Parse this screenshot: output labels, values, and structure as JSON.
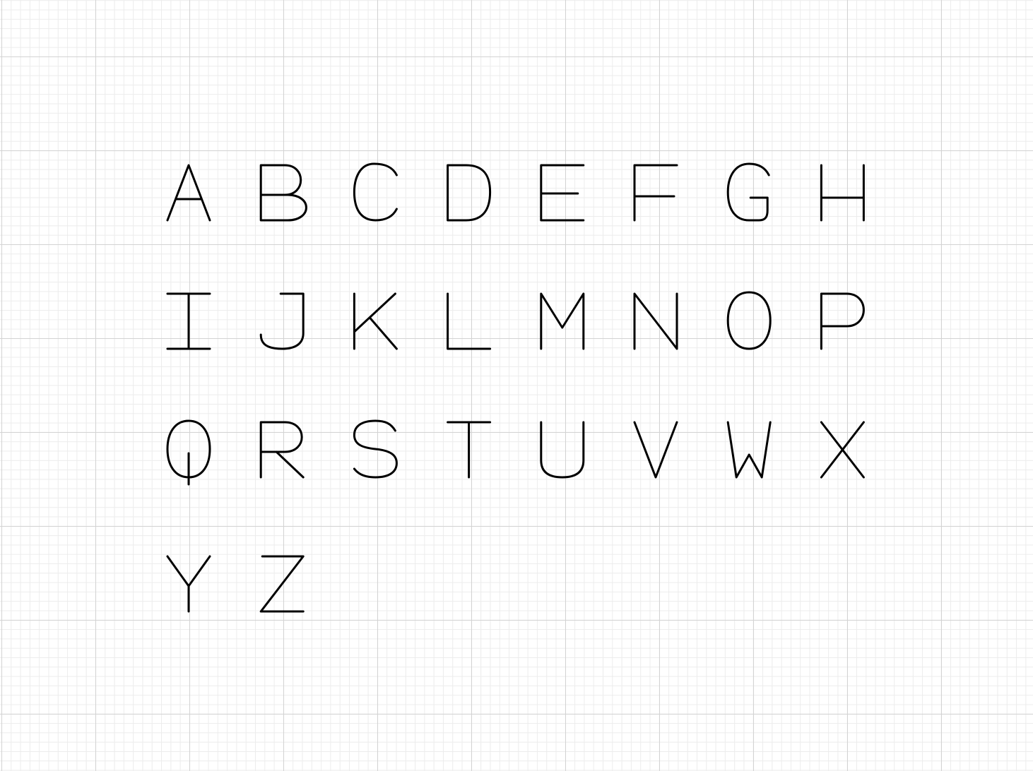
{
  "canvas": {
    "background": "#ffffff",
    "grid_major_color": "#d3d3d3",
    "grid_minor_color": "#ececec",
    "stroke_color": "#000000"
  },
  "letters": [
    "A",
    "B",
    "C",
    "D",
    "E",
    "F",
    "G",
    "H",
    "I",
    "J",
    "K",
    "L",
    "M",
    "N",
    "O",
    "P",
    "Q",
    "R",
    "S",
    "T",
    "U",
    "V",
    "W",
    "X",
    "Y",
    "Z"
  ]
}
